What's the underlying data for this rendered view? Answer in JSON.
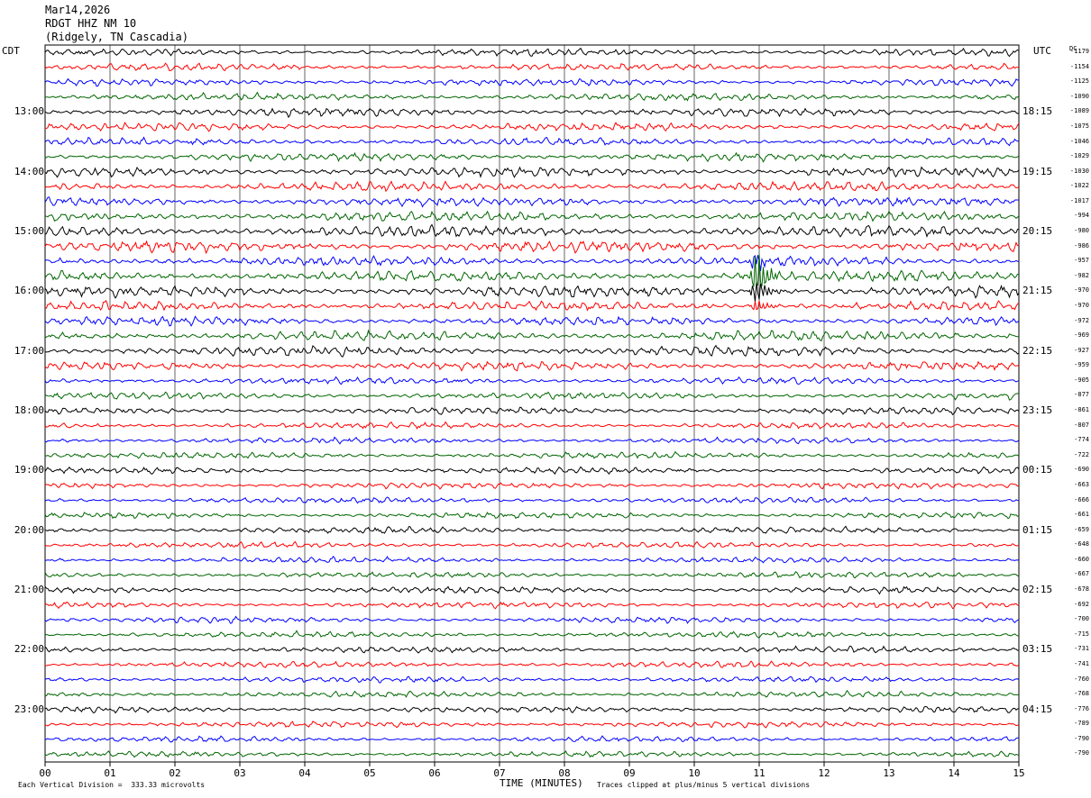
{
  "header": {
    "date": "Mar14,2026",
    "station": "RDGT HHZ NM 10",
    "location": "(Ridgely, TN Cascadia)"
  },
  "left_tz": "CDT",
  "right_tz": "UTC",
  "dc_label": "DC",
  "footer": {
    "scale": "Each Vertical Division =  333.33 microvolts",
    "clip": "Traces clipped at plus/minus 5 vertical divisions",
    "xlabel": "TIME (MINUTES)"
  },
  "colors": {
    "trace_cycle": [
      "#000000",
      "#ff0000",
      "#0000ff",
      "#006600"
    ],
    "grid": "#000000"
  },
  "chart_data": {
    "type": "line",
    "xlabel": "TIME (MINUTES)",
    "x_ticks": [
      "00",
      "01",
      "02",
      "03",
      "04",
      "05",
      "06",
      "07",
      "08",
      "09",
      "10",
      "11",
      "12",
      "13",
      "14",
      "15"
    ],
    "xlim": [
      0,
      15
    ],
    "rows": 48,
    "left_labels": [
      "13:00",
      "14:00",
      "15:00",
      "16:00",
      "17:00",
      "18:00",
      "19:00",
      "20:00",
      "21:00",
      "22:00",
      "23:00"
    ],
    "right_labels": [
      "18:15",
      "19:15",
      "20:15",
      "21:15",
      "22:15",
      "23:15",
      "00:15",
      "01:15",
      "02:15",
      "03:15",
      "04:15"
    ],
    "dc_offsets": [
      "-1179",
      "-1154",
      "-1125",
      "-1090",
      "-1089",
      "-1075",
      "-1046",
      "-1029",
      "-1030",
      "-1022",
      "-1017",
      "-994",
      "-980",
      "-986",
      "-957",
      "-982",
      "-970",
      "-970",
      "-972",
      "-969",
      "-927",
      "-959",
      "-905",
      "-877",
      "-861",
      "-807",
      "-774",
      "-722",
      "-690",
      "-663",
      "-666",
      "-661",
      "-659",
      "-648",
      "-660",
      "-667",
      "-678",
      "-692",
      "-700",
      "-715",
      "-731",
      "-741",
      "-760",
      "-768",
      "-776",
      "-789",
      "-790",
      "-790"
    ],
    "row_amplitude": [
      3.2,
      3.0,
      3.0,
      3.2,
      3.6,
      3.4,
      3.2,
      3.4,
      4.2,
      4.2,
      4.0,
      4.2,
      4.8,
      4.8,
      4.2,
      4.8,
      4.8,
      4.0,
      3.8,
      4.4,
      4.4,
      3.6,
      3.0,
      3.0,
      3.0,
      2.6,
      2.6,
      2.8,
      2.8,
      2.6,
      2.6,
      2.6,
      2.8,
      2.6,
      2.6,
      2.6,
      2.8,
      2.6,
      2.6,
      2.6,
      2.6,
      2.6,
      2.6,
      2.6,
      2.6,
      2.6,
      2.4,
      2.4
    ],
    "event": {
      "minute": 10.95,
      "rows": [
        14,
        15,
        16,
        17
      ],
      "peak_amplitude": [
        10,
        26,
        14,
        7
      ],
      "series_color_index": 3
    }
  }
}
